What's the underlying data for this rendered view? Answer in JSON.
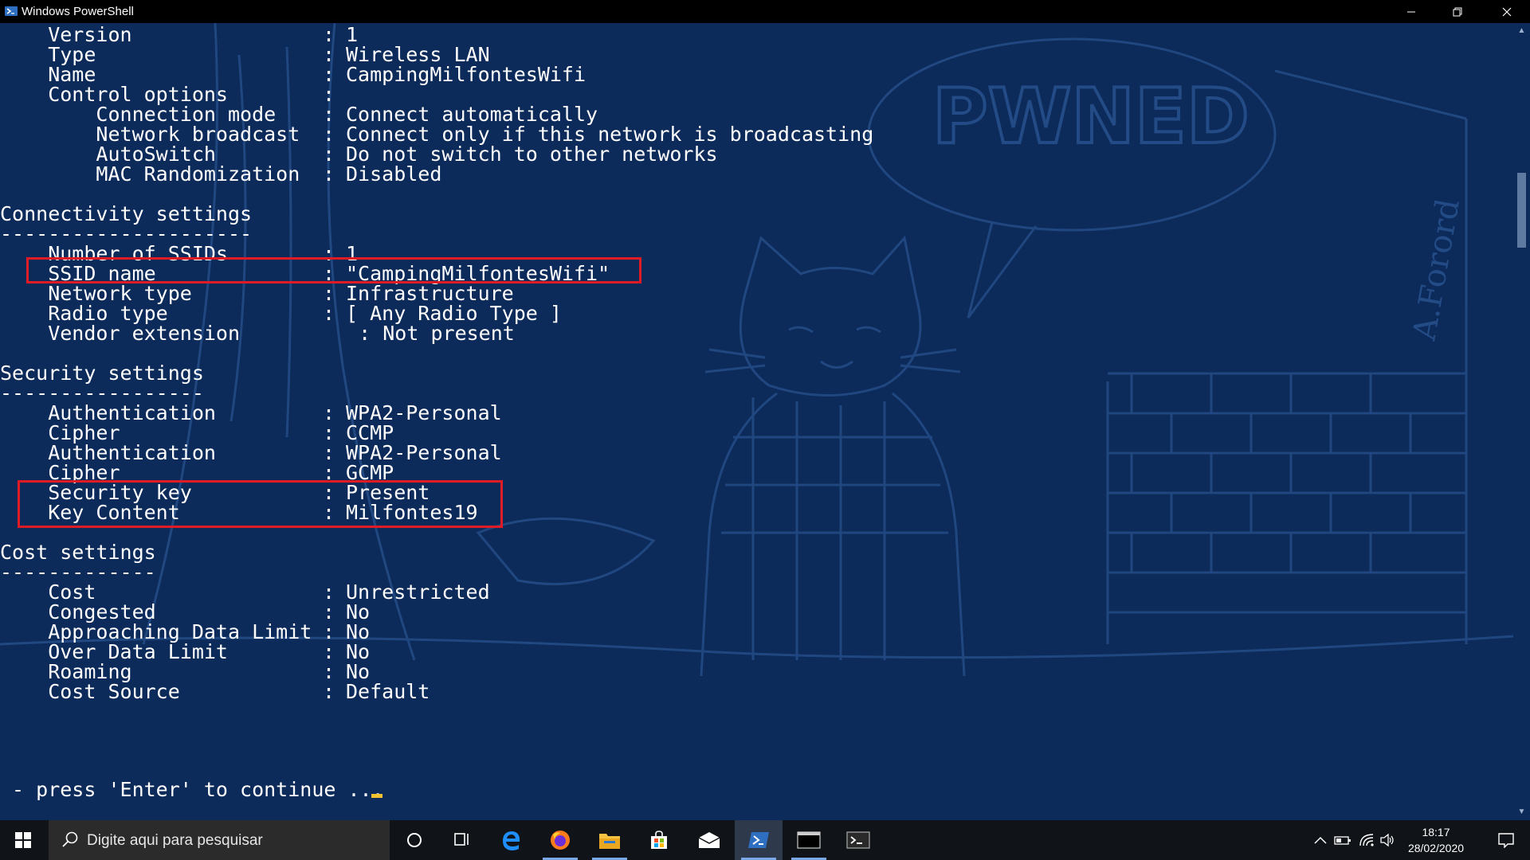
{
  "window": {
    "title": "Windows PowerShell"
  },
  "console": {
    "lines": [
      {
        "label": "    Version",
        "sep": ":",
        "value": "1"
      },
      {
        "label": "    Type",
        "sep": ":",
        "value": "Wireless LAN"
      },
      {
        "label": "    Name",
        "sep": ":",
        "value": "CampingMilfontesWifi"
      },
      {
        "label": "    Control options",
        "sep": ":",
        "value": ""
      },
      {
        "label": "        Connection mode",
        "sep": ":",
        "value": "Connect automatically"
      },
      {
        "label": "        Network broadcast",
        "sep": ":",
        "value": "Connect only if this network is broadcasting"
      },
      {
        "label": "        AutoSwitch",
        "sep": ":",
        "value": "Do not switch to other networks"
      },
      {
        "label": "        MAC Randomization",
        "sep": ":",
        "value": "Disabled"
      },
      {
        "label": "",
        "sep": "",
        "value": ""
      },
      {
        "label": "Connectivity settings",
        "sep": "",
        "value": ""
      },
      {
        "label": "---------------------",
        "sep": "",
        "value": ""
      },
      {
        "label": "    Number of SSIDs",
        "sep": ":",
        "value": "1"
      },
      {
        "label": "    SSID name",
        "sep": ":",
        "value": "\"CampingMilfontesWifi\""
      },
      {
        "label": "    Network type",
        "sep": ":",
        "value": "Infrastructure"
      },
      {
        "label": "    Radio type",
        "sep": ":",
        "value": "[ Any Radio Type ]"
      },
      {
        "label": "    Vendor extension",
        "sep": "",
        "value": "   : Not present"
      },
      {
        "label": "",
        "sep": "",
        "value": ""
      },
      {
        "label": "Security settings",
        "sep": "",
        "value": ""
      },
      {
        "label": "-----------------",
        "sep": "",
        "value": ""
      },
      {
        "label": "    Authentication",
        "sep": ":",
        "value": "WPA2-Personal"
      },
      {
        "label": "    Cipher",
        "sep": ":",
        "value": "CCMP"
      },
      {
        "label": "    Authentication",
        "sep": ":",
        "value": "WPA2-Personal"
      },
      {
        "label": "    Cipher",
        "sep": ":",
        "value": "GCMP"
      },
      {
        "label": "    Security key",
        "sep": ":",
        "value": "Present"
      },
      {
        "label": "    Key Content",
        "sep": ":",
        "value": "Milfontes19"
      },
      {
        "label": "",
        "sep": "",
        "value": ""
      },
      {
        "label": "Cost settings",
        "sep": "",
        "value": ""
      },
      {
        "label": "-------------",
        "sep": "",
        "value": ""
      },
      {
        "label": "    Cost",
        "sep": ":",
        "value": "Unrestricted"
      },
      {
        "label": "    Congested",
        "sep": ":",
        "value": "No"
      },
      {
        "label": "    Approaching Data Limit",
        "sep": ":",
        "value": "No"
      },
      {
        "label": "    Over Data Limit",
        "sep": ":",
        "value": "No"
      },
      {
        "label": "    Roaming",
        "sep": ":",
        "value": "No"
      },
      {
        "label": "    Cost Source",
        "sep": ":",
        "value": "Default"
      }
    ],
    "prompt": " - press 'Enter' to continue ..."
  },
  "background_art": {
    "text": "PWNED",
    "signature": "A.Forord"
  },
  "highlight_color": "#e01b24",
  "console_background": "#0c2a5a",
  "taskbar": {
    "search_placeholder": "Digite aqui para pesquisar",
    "apps": [
      "cortana-icon",
      "task-view-icon",
      "edge-icon",
      "firefox-icon",
      "file-explorer-icon",
      "store-icon",
      "mail-icon",
      "powershell-icon",
      "cmd-icon",
      "terminal-icon"
    ],
    "clock_time": "18:17",
    "clock_date": "28/02/2020"
  }
}
